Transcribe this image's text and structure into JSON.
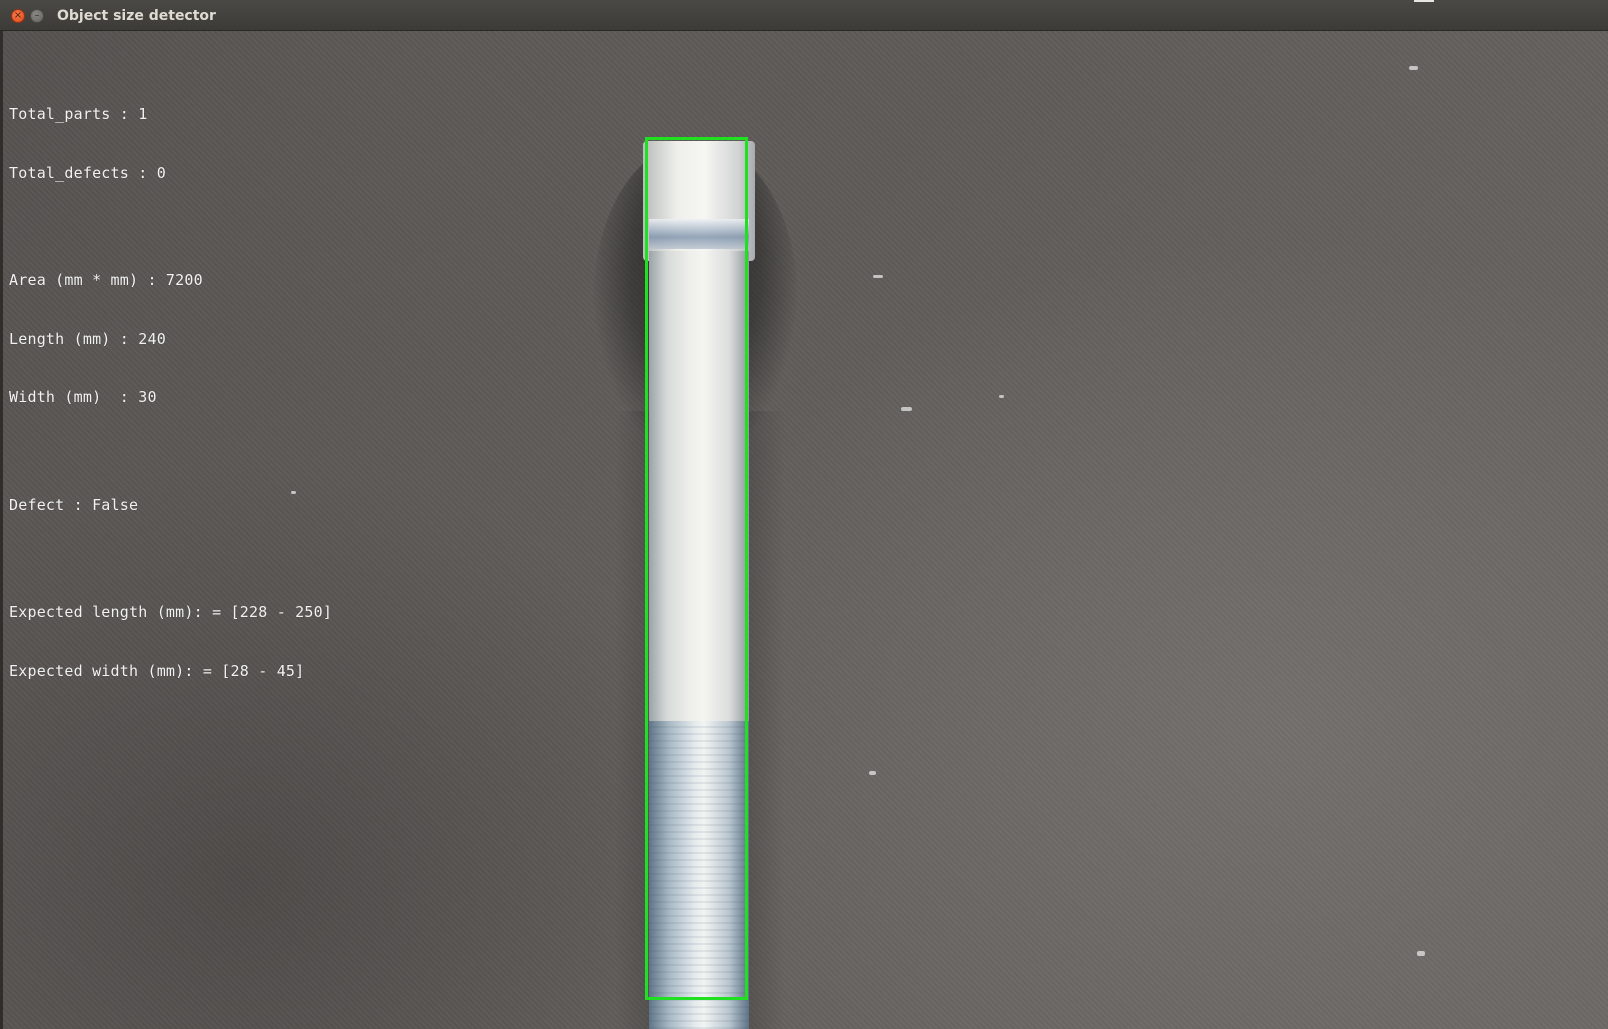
{
  "window": {
    "title": "Object size detector",
    "close_symbol": "×",
    "minimize_symbol": "–",
    "close_icon": "close-icon",
    "minimize_icon": "minimize-icon"
  },
  "overlay": {
    "total_parts": "Total_parts : 1",
    "total_defects": "Total_defects : 0",
    "area": "Area (mm * mm) : 7200",
    "length": "Length (mm) : 240",
    "width": "Width (mm)  : 30",
    "defect": "Defect : False",
    "expected_length": "Expected length (mm): = [228 - 250]",
    "expected_width": "Expected width (mm): = [28 - 45]"
  },
  "detection": {
    "box_color": "#21e021",
    "object": "bolt"
  },
  "colors": {
    "title_bar": "#3c3b37",
    "close_button": "#df4b16",
    "overlay_text": "#f2f2f2"
  }
}
